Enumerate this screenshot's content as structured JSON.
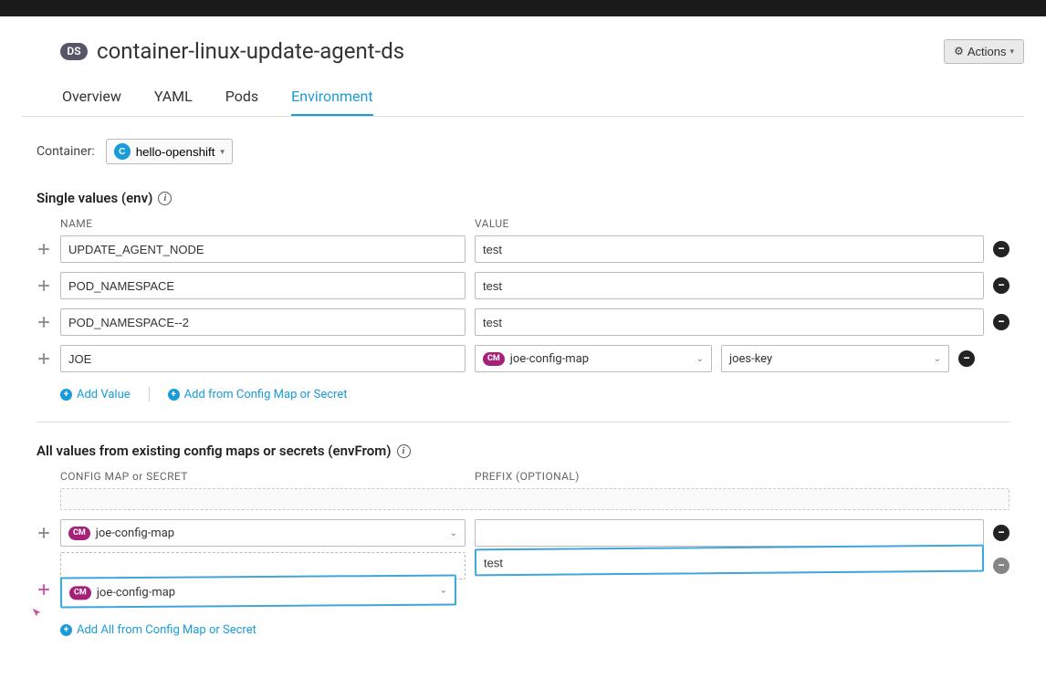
{
  "header": {
    "badge": "DS",
    "title": "container-linux-update-agent-ds",
    "actions_label": "Actions"
  },
  "tabs": [
    {
      "label": "Overview",
      "active": false
    },
    {
      "label": "YAML",
      "active": false
    },
    {
      "label": "Pods",
      "active": false
    },
    {
      "label": "Environment",
      "active": true
    }
  ],
  "container": {
    "label": "Container:",
    "badge": "C",
    "selected": "hello-openshift"
  },
  "env_section": {
    "title": "Single values (env)",
    "col_name": "NAME",
    "col_value": "VALUE",
    "rows": [
      {
        "name": "UPDATE_AGENT_NODE",
        "value": "test",
        "type": "text"
      },
      {
        "name": "POD_NAMESPACE",
        "value": "test",
        "type": "text"
      },
      {
        "name": "POD_NAMESPACE--2",
        "value": "test",
        "type": "text"
      },
      {
        "name": "JOE",
        "type": "cm",
        "cm_badge": "CM",
        "cm_name": "joe-config-map",
        "key": "joes-key"
      }
    ],
    "add_value": "Add Value",
    "add_cm": "Add from Config Map or Secret"
  },
  "envfrom_section": {
    "title": "All values from existing config maps or secrets (envFrom)",
    "col_cm": "CONFIG MAP or SECRET",
    "col_prefix": "PREFIX (OPTIONAL)",
    "rows": [
      {
        "cm_badge": "CM",
        "cm_name": "joe-config-map",
        "prefix": "",
        "dragging": false
      },
      {
        "cm_badge": "CM",
        "cm_name": "joe-config-map",
        "prefix": "test",
        "dragging": true
      }
    ],
    "add_all": "Add All from Config Map or Secret"
  }
}
